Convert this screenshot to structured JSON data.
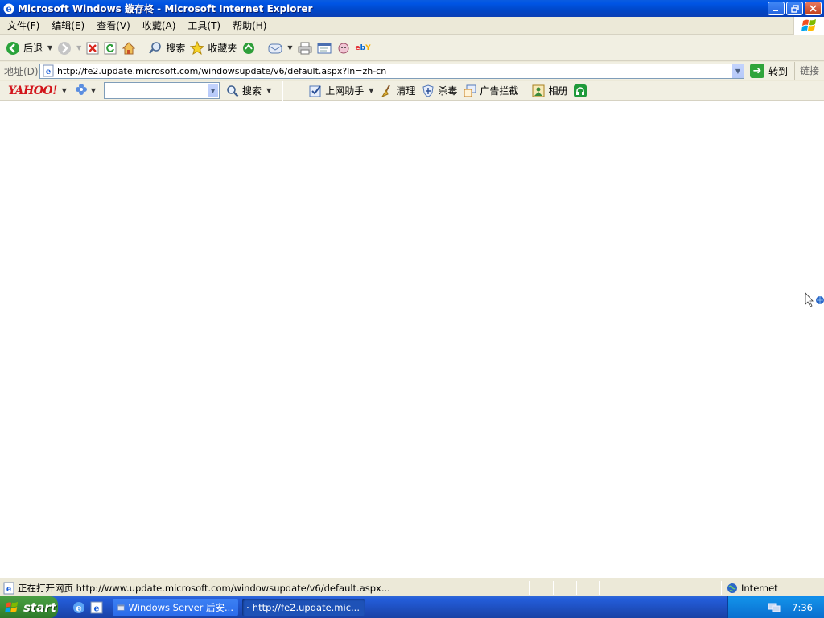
{
  "window": {
    "title": "Microsoft Windows 鏇存柊 - Microsoft Internet Explorer",
    "icon": "ie-icon",
    "buttons": [
      "minimize",
      "restore",
      "close"
    ]
  },
  "menubar": {
    "items": [
      "文件(F)",
      "编辑(E)",
      "查看(V)",
      "收藏(A)",
      "工具(T)",
      "帮助(H)"
    ]
  },
  "toolbar": {
    "back_label": "后退",
    "search_label": "搜索",
    "favorites_label": "收藏夹"
  },
  "addressbar": {
    "label": "地址(D)",
    "url": "http://fe2.update.microsoft.com/windowsupdate/v6/default.aspx?ln=zh-cn",
    "go_label": "转到",
    "links_label": "链接"
  },
  "yahoo": {
    "logo": "YAHOO!",
    "search_value": "",
    "search_label": "搜索",
    "assistant_label": "上网助手",
    "clean_label": "清理",
    "antivirus_label": "杀毒",
    "adblock_label": "广告拦截",
    "album_label": "相册"
  },
  "status": {
    "text": "正在打开网页 http://www.update.microsoft.com/windowsupdate/v6/default.aspx...",
    "zone": "Internet"
  },
  "taskbar": {
    "start_label": "start",
    "tasks": [
      {
        "label": "Windows Server 后安...",
        "active": false
      },
      {
        "label": "http://fe2.update.mic...",
        "active": true
      }
    ],
    "clock": "7:36"
  },
  "colors": {
    "titlebar": "#0055e5",
    "taskbar": "#245edb",
    "start": "#3c8f35",
    "yahoo": "#d2151b"
  }
}
